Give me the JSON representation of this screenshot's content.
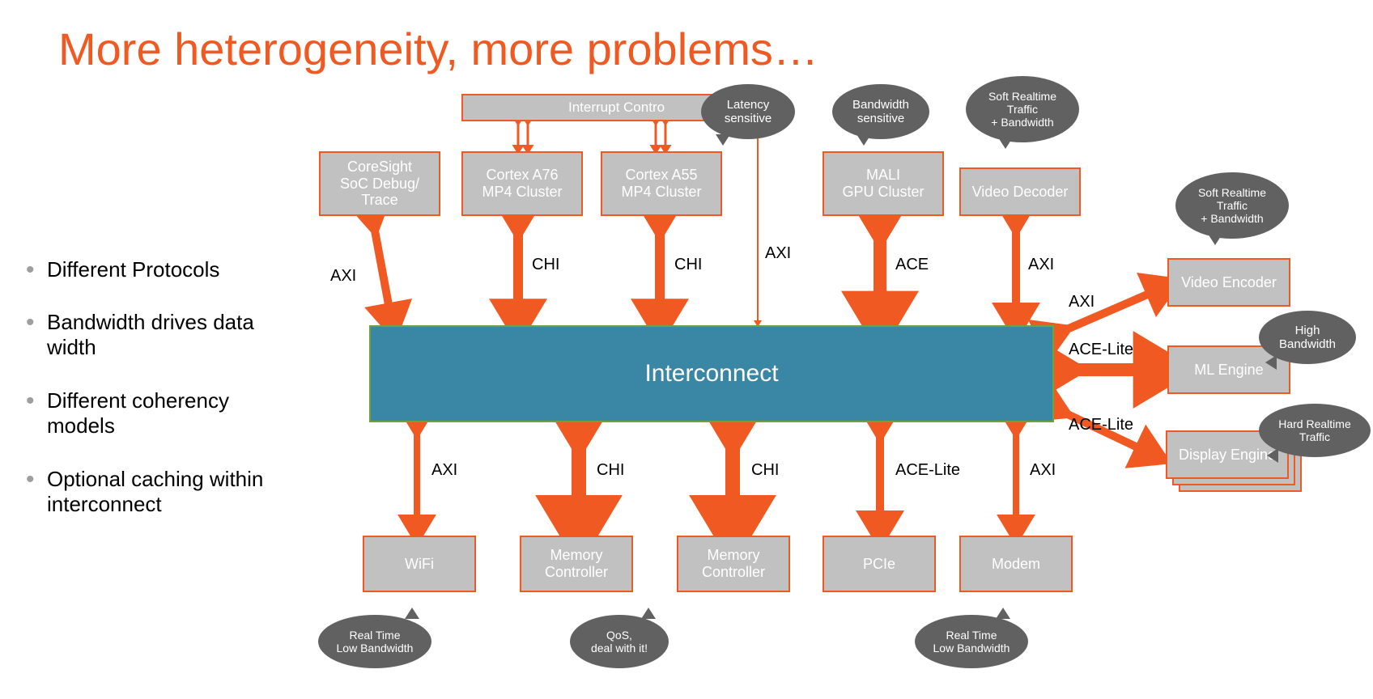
{
  "title": "More heterogeneity, more problems…",
  "bullets": [
    "Different Protocols",
    "Bandwidth drives data width",
    "Different coherency models",
    "Optional caching within interconnect"
  ],
  "interconnect": "Interconnect",
  "top_blocks": {
    "interrupt": "Interrupt Contro",
    "coresight": "CoreSight\nSoC Debug/\nTrace",
    "a76": "Cortex A76\nMP4 Cluster",
    "a55": "Cortex A55\nMP4 Cluster",
    "mali": "MALI\nGPU Cluster",
    "vdec": "Video Decoder"
  },
  "bottom_blocks": {
    "wifi": "WiFi",
    "mem1": "Memory\nController",
    "mem2": "Memory\nController",
    "pcie": "PCIe",
    "modem": "Modem"
  },
  "right_blocks": {
    "venc": "Video Encoder",
    "ml": "ML Engine",
    "display": "Display Engine"
  },
  "protocols": {
    "axi": "AXI",
    "chi": "CHI",
    "ace": "ACE",
    "ace_lite": "ACE-Lite"
  },
  "bubbles": {
    "latency": "Latency\nsensitive",
    "bw_sensitive": "Bandwidth\nsensitive",
    "soft_rt_bw": "Soft Realtime\nTraffic\n+ Bandwidth",
    "high_bw": "High\nBandwidth",
    "hard_rt": "Hard Realtime\nTraffic",
    "rt_low_bw": "Real Time\nLow Bandwidth",
    "qos": "QoS,\ndeal with it!"
  }
}
